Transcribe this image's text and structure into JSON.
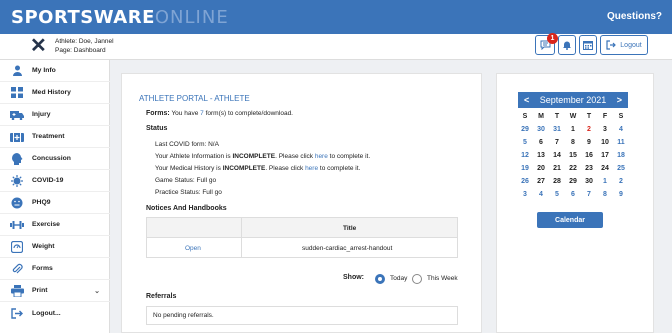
{
  "brand": {
    "bold": "SPORTSWARE",
    "light": "ONLINE"
  },
  "header": {
    "questions": "Questions?",
    "athlete_label": "Athlete: Doe, Jannel",
    "page_label": "Page: Dashboard",
    "badge_count": "1",
    "logout_label": "Logout"
  },
  "sidebar": {
    "items": [
      {
        "label": "My Info"
      },
      {
        "label": "Med History"
      },
      {
        "label": "Injury"
      },
      {
        "label": "Treatment"
      },
      {
        "label": "Concussion"
      },
      {
        "label": "COVID-19"
      },
      {
        "label": "PHQ9"
      },
      {
        "label": "Exercise"
      },
      {
        "label": "Weight"
      },
      {
        "label": "Forms"
      },
      {
        "label": "Print"
      },
      {
        "label": "Logout..."
      }
    ]
  },
  "main": {
    "title": "ATHLETE PORTAL - ATHLETE",
    "forms_label": "Forms:",
    "forms_pre": "You have",
    "forms_count": "7",
    "forms_post": "form(s) to complete/download.",
    "status_title": "Status",
    "last_covid": "Last COVID form: N/A",
    "info_pre": "Your Athlete Information is",
    "incomplete": "INCOMPLETE",
    "please_click": ". Please click",
    "here": "here",
    "to_complete": "to complete it.",
    "med_pre": "Your Medical History is",
    "game_status": "Game Status:  Full go",
    "practice_status": "Practice Status:  Full go",
    "notices_title": "Notices And Handbooks",
    "table_header": "Title",
    "row_action": "Open",
    "row_title": "sudden-cardiac_arrest-handout",
    "show_label": "Show:",
    "today": "Today",
    "this_week": "This Week",
    "referrals_title": "Referrals",
    "no_referrals": "No pending referrals."
  },
  "calendar": {
    "prev": "<",
    "month": "September 2021",
    "next": ">",
    "weekdays": [
      "S",
      "M",
      "T",
      "W",
      "T",
      "F",
      "S"
    ],
    "weeks": [
      [
        "29",
        "30",
        "31",
        "1",
        "2",
        "3",
        "4"
      ],
      [
        "5",
        "6",
        "7",
        "8",
        "9",
        "10",
        "11"
      ],
      [
        "12",
        "13",
        "14",
        "15",
        "16",
        "17",
        "18"
      ],
      [
        "19",
        "20",
        "21",
        "22",
        "23",
        "24",
        "25"
      ],
      [
        "26",
        "27",
        "28",
        "29",
        "30",
        "1",
        "2"
      ],
      [
        "3",
        "4",
        "5",
        "6",
        "7",
        "8",
        "9"
      ]
    ],
    "button": "Calendar",
    "accent": "#3b74b9",
    "today_color": "#d9261c"
  }
}
